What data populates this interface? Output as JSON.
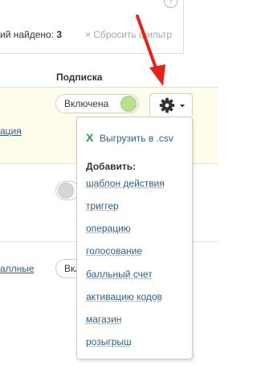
{
  "filter": {
    "help_icon": "?",
    "found_label": "ий найдено:",
    "found_count": "3",
    "reset_label": "× Сбросить фильтр"
  },
  "table": {
    "subscription_header": "Подписка",
    "rows": [
      {
        "link_text": "ация",
        "toggle_label": "Включена",
        "toggle_state": "on"
      },
      {
        "toggle_state": "off"
      },
      {
        "link_text": "аллные",
        "toggle_label": "Вкл",
        "toggle_state": "on"
      }
    ]
  },
  "gear_menu": {
    "button_icon": "gear-icon",
    "export_label": "Выгрузить в .csv",
    "add_heading": "Добавить:",
    "items": [
      "шаблон действия",
      "триггер",
      "операцию",
      "голосование",
      "балльный счет",
      "активацию кодов",
      "магазин",
      "розыгрыш"
    ]
  },
  "colors": {
    "link": "#2f5f8a",
    "toggle_on": "#b7df8e",
    "toggle_off": "#d6d6d6",
    "highlight_row": "#fffcec",
    "arrow": "#e8221b",
    "excel_icon": "#2e9a3f"
  }
}
